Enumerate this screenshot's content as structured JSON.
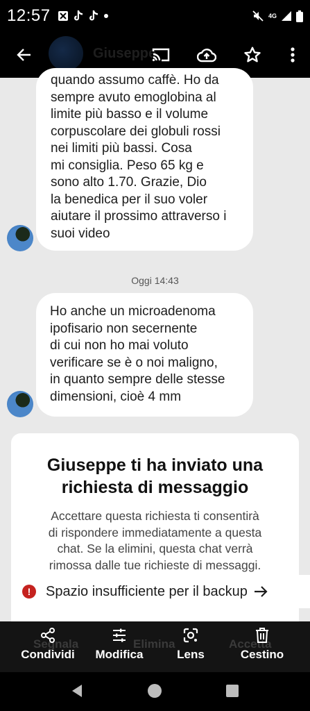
{
  "status_bar": {
    "time": "12:57",
    "network": "4G"
  },
  "thread": {
    "contact_name": "Giuseppe",
    "messages": [
      {
        "text": "quando assumo caffè. Ho da\nsempre avuto emoglobina al\nlimite più basso e il volume\ncorpuscolare dei globuli rossi\nnei limiti più bassi. Cosa\nmi consiglia. Peso 65 kg e\nsono alto 1.70. Grazie, Dio\nla benedica per il suo voler\naiutare il prossimo attraverso i\nsuoi video"
      },
      {
        "text": "Ho anche un microadenoma\nipofisario non secernente\ndi cui non ho mai voluto\nverificare se è o noi maligno,\nin quanto sempre delle stesse\ndimensioni, cioè 4 mm"
      }
    ],
    "timestamp": "Oggi 14:43"
  },
  "request": {
    "title": "Giuseppe ti ha inviato una\nrichiesta di messaggio",
    "body": "Accettare questa richiesta ti consentirà\ndi rispondere immediatamente a questa\nchat. Se la elimini, questa chat verrà\nrimossa dalle tue richieste di messaggi.",
    "buttons_behind": [
      "Segnala",
      "Elimina",
      "Accetta"
    ]
  },
  "toast": {
    "message": "Spazio insufficiente per il backup",
    "error_mark": "!"
  },
  "actions": [
    {
      "label": "Condividi",
      "icon": "share-icon"
    },
    {
      "label": "Modifica",
      "icon": "tune-icon"
    },
    {
      "label": "Lens",
      "icon": "lens-icon"
    },
    {
      "label": "Cestino",
      "icon": "trash-icon"
    }
  ],
  "colors": {
    "accent_error": "#c5221f",
    "bubble": "#ffffff",
    "background": "#e9e9e9"
  }
}
